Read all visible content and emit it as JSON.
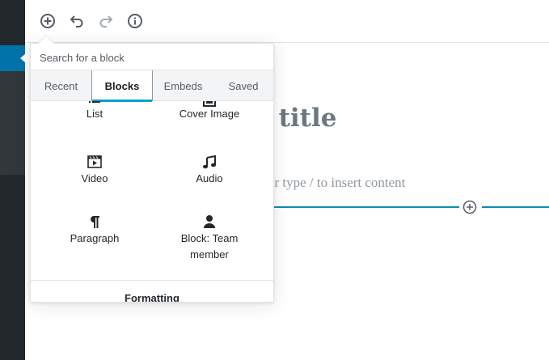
{
  "editor": {
    "title_fragment": "l title",
    "placeholder_fragment": "t or type / to insert content"
  },
  "inserter": {
    "search_placeholder": "Search for a block",
    "tabs": [
      {
        "label": "Recent",
        "selected": false
      },
      {
        "label": "Blocks",
        "selected": true
      },
      {
        "label": "Embeds",
        "selected": false
      },
      {
        "label": "Saved",
        "selected": false
      }
    ],
    "blocks": [
      {
        "label": "List",
        "icon": "list-icon"
      },
      {
        "label": "Cover Image",
        "icon": "cover-image-icon"
      },
      {
        "label": "Video",
        "icon": "video-icon"
      },
      {
        "label": "Audio",
        "icon": "audio-icon"
      },
      {
        "label": "Paragraph",
        "icon": "paragraph-icon"
      },
      {
        "label": "Block: Team member",
        "icon": "person-icon"
      }
    ],
    "next_section": "Formatting"
  },
  "colors": {
    "sidebar": "#23282d",
    "sidebar_active": "#0073aa",
    "accent": "#00a0d2",
    "inserter_line": "#0e8ab5"
  }
}
